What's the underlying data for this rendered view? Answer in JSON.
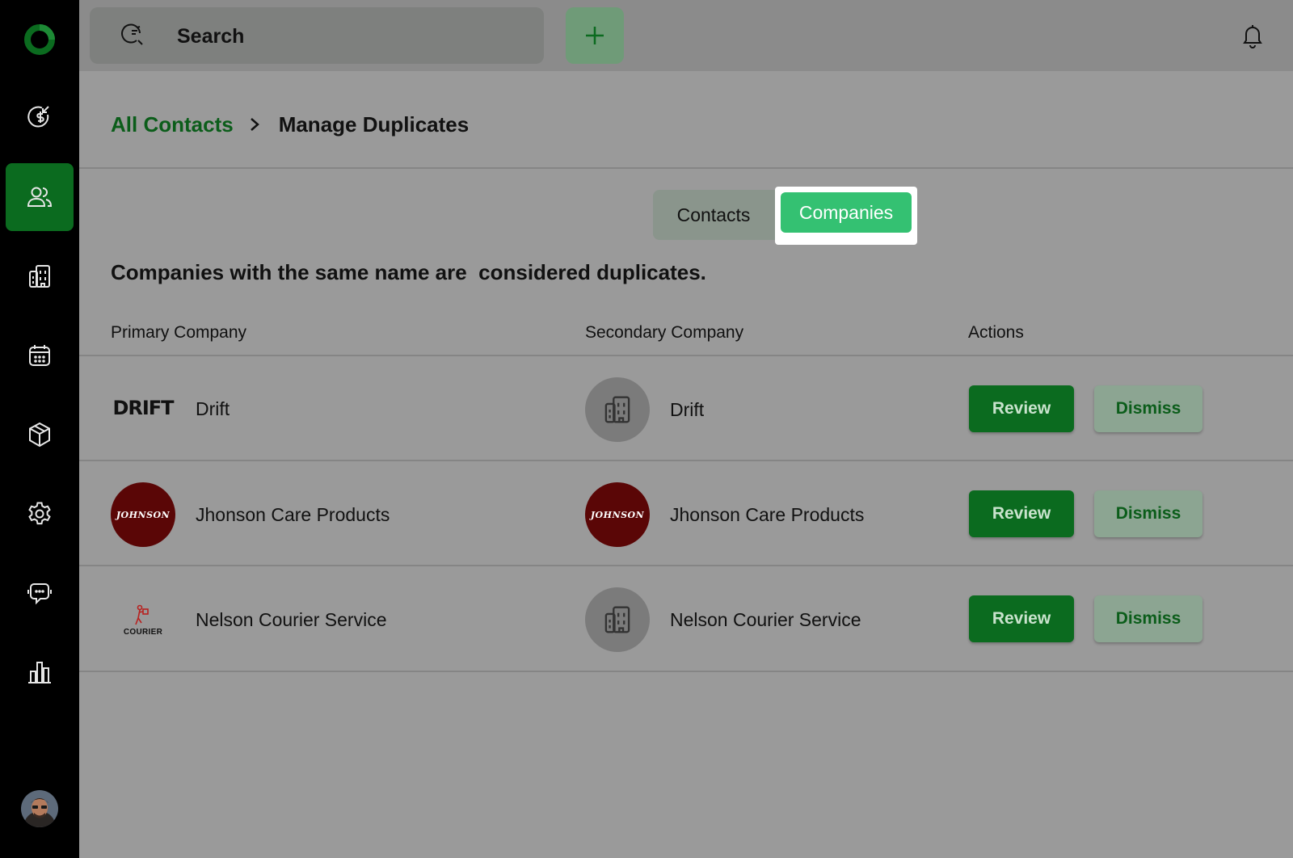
{
  "search": {
    "placeholder": "Search"
  },
  "breadcrumb": {
    "parent": "All Contacts",
    "current": "Manage Duplicates"
  },
  "toggle": {
    "contacts_label": "Contacts",
    "companies_label": "Companies",
    "selected": "Companies"
  },
  "description": "Companies with the same name are  considered duplicates.",
  "table": {
    "headers": [
      "Primary Company",
      "Secondary Company",
      "Actions"
    ],
    "rows": [
      {
        "primary_name": "Drift",
        "primary_logo": "drift-logo",
        "secondary_name": "Drift",
        "secondary_logo": "building-icon",
        "review_label": "Review",
        "dismiss_label": "Dismiss"
      },
      {
        "primary_name": "Jhonson Care Products",
        "primary_logo": "johnson-logo",
        "secondary_name": "Jhonson Care Products",
        "secondary_logo": "johnson-logo",
        "review_label": "Review",
        "dismiss_label": "Dismiss"
      },
      {
        "primary_name": "Nelson Courier Service",
        "primary_logo": "courier-logo",
        "secondary_name": "Nelson Courier Service",
        "secondary_logo": "building-icon",
        "review_label": "Review",
        "dismiss_label": "Dismiss"
      }
    ]
  },
  "logos": {
    "drift_text": "DRIFT",
    "johnson_text": "JOHNSON",
    "courier_text": "COURIER"
  },
  "colors": {
    "sidebar_bg": "#000000",
    "active_nav": "#0b6b1f",
    "accent_green": "#34c172",
    "link_green": "#0b5d1a"
  },
  "sidebar": {
    "items": [
      "deals-icon",
      "contacts-icon",
      "companies-icon",
      "calendar-icon",
      "products-icon",
      "settings-icon",
      "chat-icon",
      "reports-icon"
    ],
    "active": "contacts-icon"
  }
}
